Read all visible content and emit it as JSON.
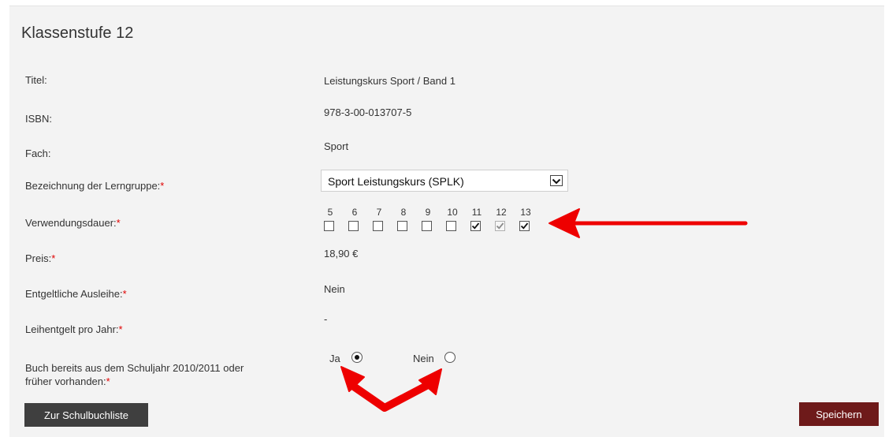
{
  "section_title": "Klassenstufe 12",
  "fields": {
    "titel": {
      "label": "Titel:",
      "value": "Leistungskurs Sport / Band 1"
    },
    "isbn": {
      "label": "ISBN:",
      "value": "978-3-00-013707-5"
    },
    "fach": {
      "label": "Fach:",
      "value": "Sport"
    },
    "lerngruppe": {
      "label": "Bezeichnung der Lerngruppe:",
      "required": "*",
      "selected": "Sport Leistungskurs (SPLK)"
    },
    "verwendungsdauer": {
      "label": "Verwendungsdauer:",
      "required": "*"
    },
    "preis": {
      "label": "Preis:",
      "required": "*",
      "value": "18,90 €"
    },
    "ausleihe": {
      "label": "Entgeltliche Ausleihe:",
      "required": "*",
      "value": "Nein"
    },
    "leihentgelt": {
      "label": "Leihentgelt pro Jahr:",
      "required": "*",
      "value": "-"
    },
    "vorhanden": {
      "label_line1": "Buch bereits aus dem Schuljahr 2010/2011 oder",
      "label_line2": "früher vorhanden:",
      "required": "*"
    }
  },
  "years": [
    {
      "label": "5",
      "checked": false,
      "disabled": false
    },
    {
      "label": "6",
      "checked": false,
      "disabled": false
    },
    {
      "label": "7",
      "checked": false,
      "disabled": false
    },
    {
      "label": "8",
      "checked": false,
      "disabled": false
    },
    {
      "label": "9",
      "checked": false,
      "disabled": false
    },
    {
      "label": "10",
      "checked": false,
      "disabled": false
    },
    {
      "label": "11",
      "checked": true,
      "disabled": false
    },
    {
      "label": "12",
      "checked": true,
      "disabled": true
    },
    {
      "label": "13",
      "checked": true,
      "disabled": false
    }
  ],
  "radio": {
    "ja": {
      "label": "Ja",
      "selected": true
    },
    "nein": {
      "label": "Nein",
      "selected": false
    }
  },
  "buttons": {
    "back": "Zur Schulbuchliste",
    "save": "Speichern"
  },
  "annotation_color": "#ee0000"
}
